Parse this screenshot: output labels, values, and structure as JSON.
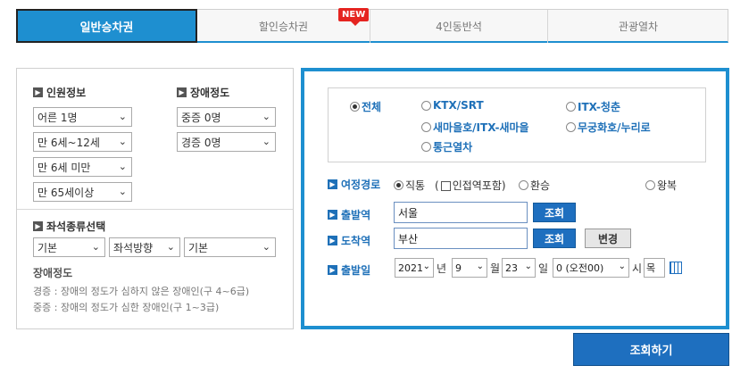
{
  "tabs": [
    {
      "label": "일반승차권"
    },
    {
      "label": "할인승차권",
      "badge": "NEW"
    },
    {
      "label": "4인동반석"
    },
    {
      "label": "관광열차"
    }
  ],
  "passengers": {
    "title": "인원정보",
    "adult": "어른 1명",
    "child": "만 6세~12세",
    "infant": "만 6세 미만",
    "senior": "만 65세이상"
  },
  "disability": {
    "title": "장애정도",
    "severe": "중증 0명",
    "mild": "경증 0명"
  },
  "seat": {
    "title": "좌석종류선택",
    "type": "기본",
    "direction": "좌석방향",
    "position": "기본"
  },
  "notes": {
    "title": "장애정도",
    "mild": "경증 : 장애의 정도가 심하지 않은 장애인(구 4~6급)",
    "severe": "중증 : 장애의 정도가 심한 장애인(구 1~3급)"
  },
  "train_types": {
    "all": "전체",
    "ktx": "KTX/SRT",
    "itx_cheongchun": "ITX-청춘",
    "saemaeul": "새마을호/ITX-새마을",
    "mugunghwa": "무궁화호/누리로",
    "commuter": "통근열차"
  },
  "route": {
    "label": "여정경로",
    "direct": "직통",
    "include_nearby": "인접역포함",
    "transfer": "환승",
    "round_trip": "왕복"
  },
  "departure": {
    "label": "출발역",
    "value": "서울",
    "lookup": "조회"
  },
  "arrival": {
    "label": "도착역",
    "value": "부산",
    "lookup": "조회",
    "swap": "변경"
  },
  "date": {
    "label": "출발일",
    "year": "2021",
    "year_unit": "년",
    "month": "9",
    "month_unit": "월",
    "day": "23",
    "day_unit": "일",
    "hour": "0 (오전00)",
    "hour_unit": "시",
    "weekday": "목"
  },
  "search_button": "조회하기",
  "colors": {
    "accent": "#1e8fd0",
    "button": "#1e6fbf",
    "badge": "#e52420"
  }
}
